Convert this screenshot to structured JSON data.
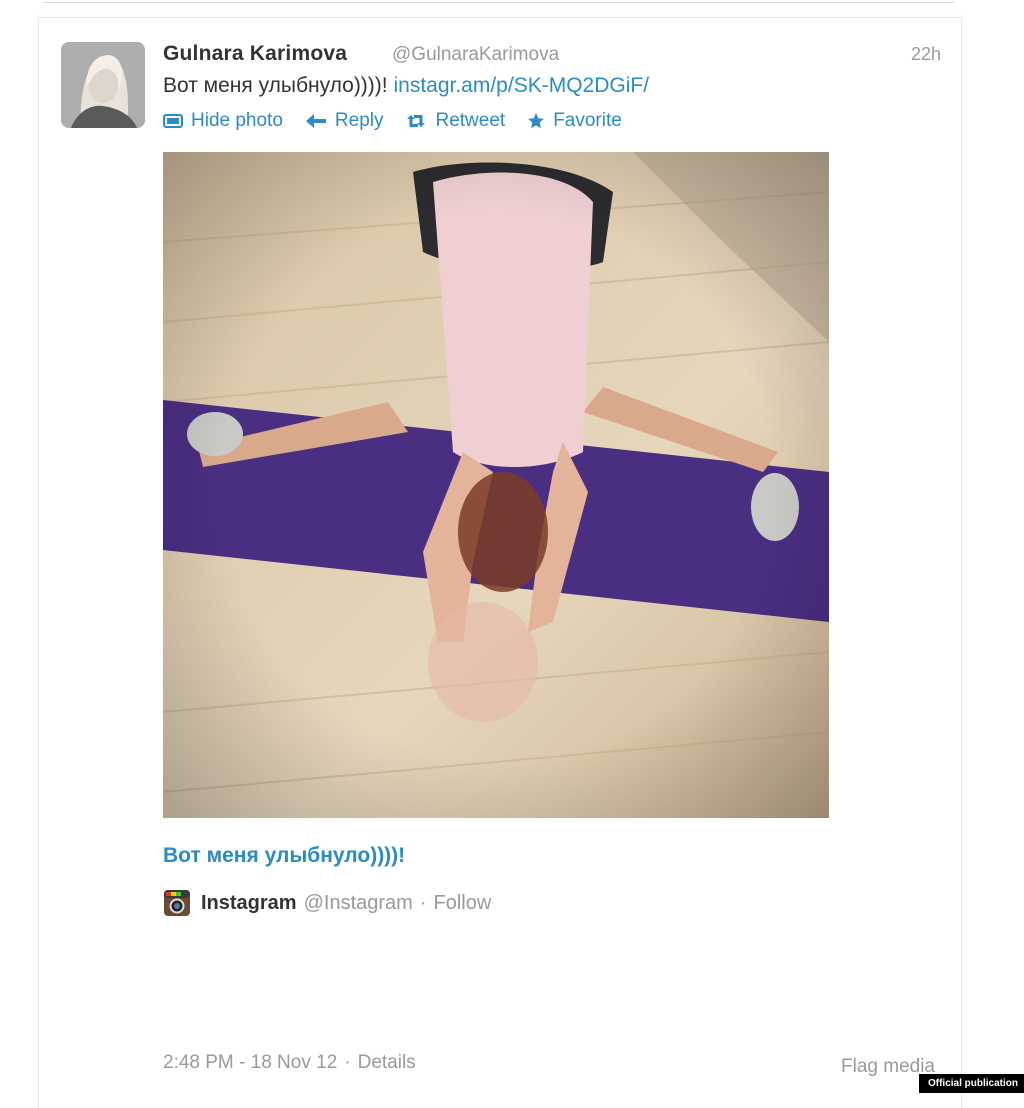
{
  "tweet": {
    "author_name": "Gulnara Karimova",
    "author_handle": "@GulnaraKarimova",
    "time": "22h",
    "text": "Вот меня улыбнуло))))!",
    "link": "instagr.am/p/SK-MQ2DGiF/",
    "actions": {
      "hide_photo": "Hide photo",
      "reply": "Reply",
      "retweet": "Retweet",
      "favorite": "Favorite"
    },
    "media_caption": "Вот меня улыбнуло))))!",
    "source": {
      "name": "Instagram",
      "handle": "@Instagram",
      "separator": "·",
      "follow": "Follow"
    },
    "posted_at": "2:48 PM - 18 Nov 12",
    "details": "Details",
    "flag_media": "Flag media"
  },
  "colors": {
    "link": "#2a8bc9",
    "muted": "#999999",
    "text": "#333333",
    "mat": "#4a2e82"
  },
  "badge": "Official publication"
}
